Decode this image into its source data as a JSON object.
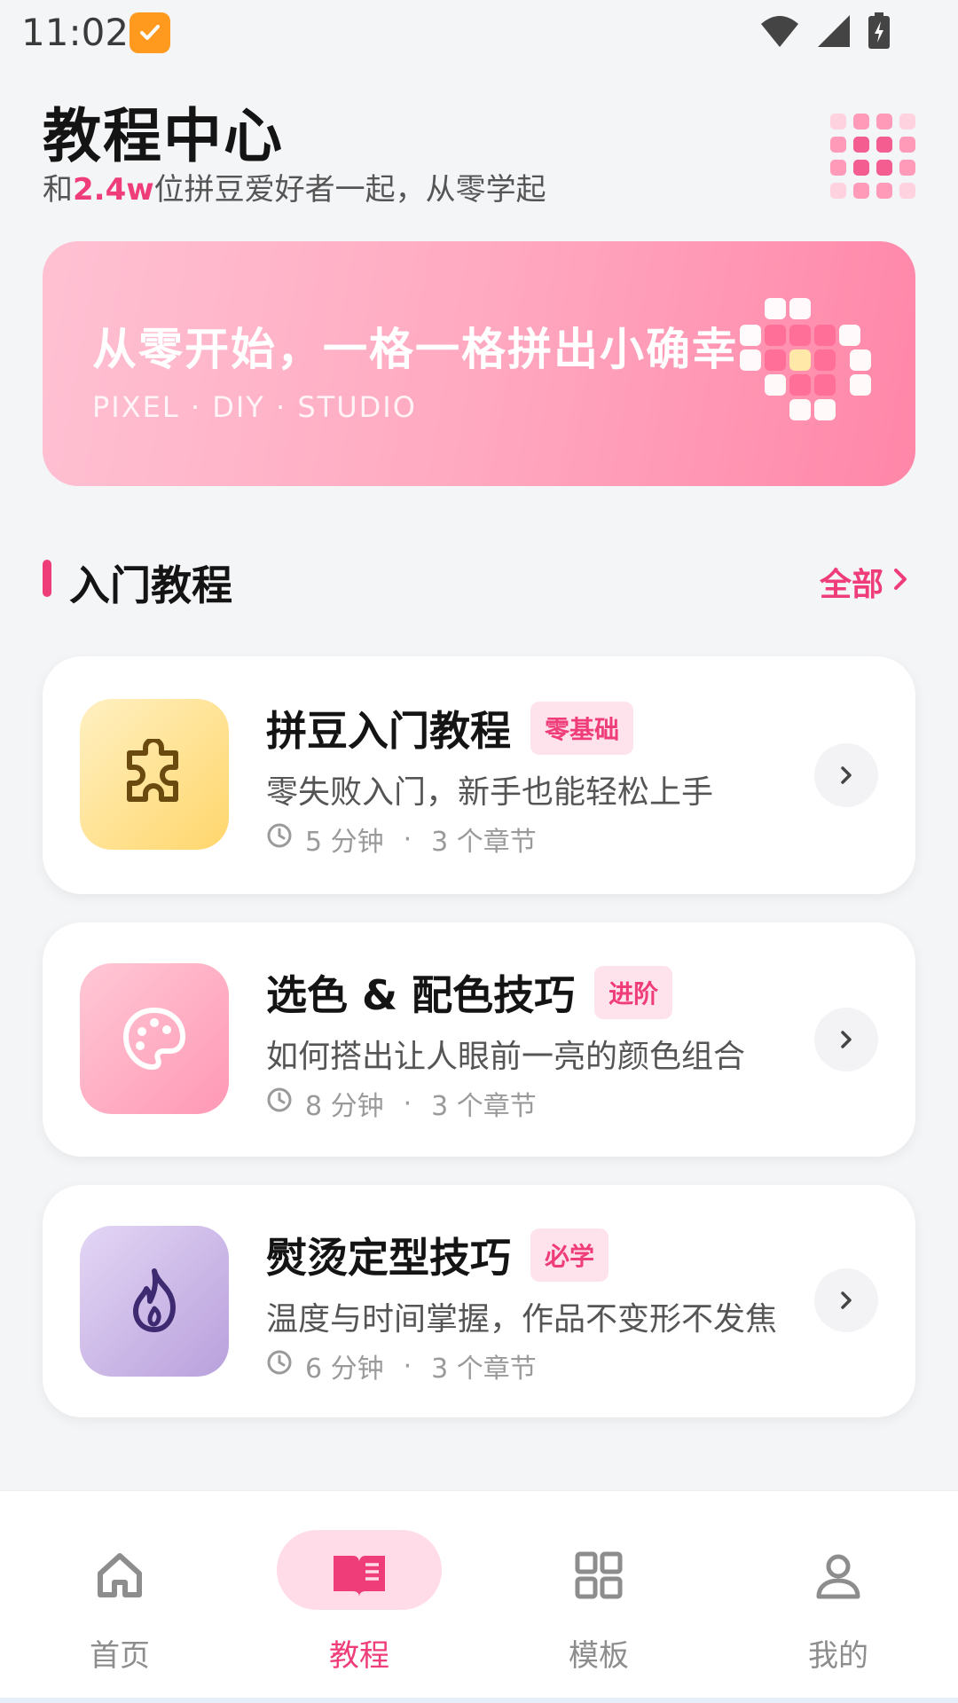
{
  "status_bar": {
    "time": "11:02"
  },
  "header": {
    "title": "教程中心",
    "subtitle_prefix": "和",
    "subtitle_highlight": "2.4w",
    "subtitle_suffix": "位拼豆爱好者一起，从零学起"
  },
  "banner": {
    "title": "从零开始，一格一格拼出小确幸",
    "subtitle": "PIXEL · DIY · STUDIO"
  },
  "section": {
    "title": "入门教程",
    "more_label": "全部"
  },
  "tutorials": [
    {
      "title": "拼豆入门教程",
      "tag": "零基础",
      "description": "零失败入门，新手也能轻松上手",
      "duration": "5 分钟",
      "chapters": "3 个章节",
      "icon": "puzzle-icon"
    },
    {
      "title": "选色 & 配色技巧",
      "tag": "进阶",
      "description": "如何搭出让人眼前一亮的颜色组合",
      "duration": "8 分钟",
      "chapters": "3 个章节",
      "icon": "palette-icon"
    },
    {
      "title": "熨烫定型技巧",
      "tag": "必学",
      "description": "温度与时间掌握，作品不变形不发焦",
      "duration": "6 分钟",
      "chapters": "3 个章节",
      "icon": "flame-icon"
    }
  ],
  "bottom_nav": [
    {
      "label": "首页",
      "icon": "home-icon",
      "active": false
    },
    {
      "label": "教程",
      "icon": "book-icon",
      "active": true
    },
    {
      "label": "模板",
      "icon": "grid-icon",
      "active": false
    },
    {
      "label": "我的",
      "icon": "user-icon",
      "active": false
    }
  ],
  "colors": {
    "accent": "#ef3d7a",
    "background": "#f4f5f7"
  }
}
